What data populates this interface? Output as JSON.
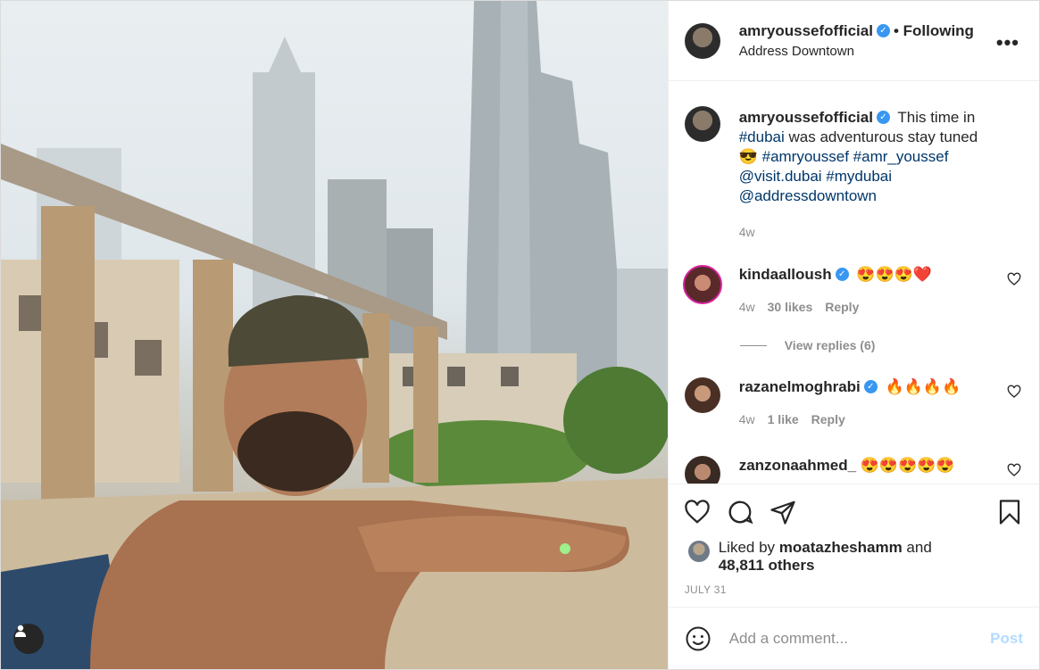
{
  "post": {
    "username": "amryoussefofficial",
    "follow_status": "• Following",
    "location": "Address Downtown",
    "more_label": "•••"
  },
  "caption": {
    "username": "amryoussefofficial",
    "text_before": " This time in ",
    "tag_dubai": "#dubai",
    "text_after": " was adventurous stay tuned",
    "emoji": "😎",
    "tags_line2": " #amryoussef #amr_youssef",
    "tags_line3": "@visit.dubai #mydubai",
    "tags_line4": "@addressdowntown",
    "age": "4w"
  },
  "comments": [
    {
      "username": "kindaalloush",
      "text": "😍😍😍❤️",
      "age": "4w",
      "likes": "30 likes",
      "reply": "Reply",
      "view_replies": "View replies (6)"
    },
    {
      "username": "razanelmoghrabi",
      "text": "🔥🔥🔥🔥",
      "age": "4w",
      "likes": "1 like",
      "reply": "Reply"
    },
    {
      "username": "zanzonaahmed_",
      "text": "😍😍😍😍😍"
    }
  ],
  "likes": {
    "prefix": "Liked by ",
    "user": "moatazheshamm",
    "middle": " and",
    "count": "48,811 others"
  },
  "date": "JULY 31",
  "add_comment": {
    "placeholder": "Add a comment...",
    "post_label": "Post"
  },
  "colors": {
    "verified": "#3897f0",
    "link": "#00376b",
    "muted": "#8e8e8e",
    "post_disabled": "#b3dbff"
  },
  "icons": [
    "heart-icon",
    "comment-icon",
    "share-icon",
    "bookmark-icon",
    "emoji-icon",
    "user-tag-icon",
    "more-icon",
    "verified-badge-icon"
  ]
}
